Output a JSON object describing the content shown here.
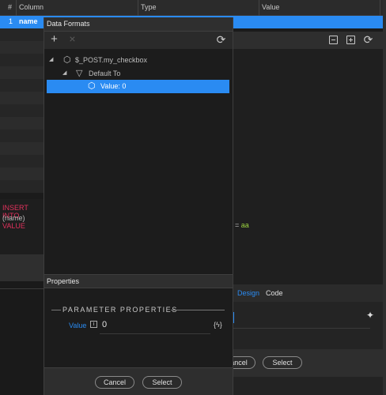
{
  "table": {
    "headers": [
      "#",
      "Column",
      "Type",
      "Value"
    ],
    "row": {
      "num": "1",
      "name": "name"
    }
  },
  "sql": {
    "line1": "INSERT INTO",
    "line2a": "(name) ",
    "line2b": "VALUE"
  },
  "dialog": {
    "title": "Data Formats",
    "tree": [
      {
        "label": "$_POST.my_checkbox"
      },
      {
        "label": "Default To"
      },
      {
        "label": "Value: 0"
      }
    ],
    "properties_title": "Properties",
    "param_heading": "PARAMETER PROPERTIES",
    "param_label": "Value",
    "param_value": "0",
    "param_expr_icon": "{ϟ}",
    "cancel_label": "Cancel",
    "select_label": "Select"
  },
  "right": {
    "code_text": "= ",
    "code_value": "aa",
    "tab_design": "Design",
    "tab_code": "Code",
    "cancel_label": "ancel",
    "select_label": "Select"
  },
  "colors": {
    "accent": "#2a8bf2",
    "sql_keyword": "#e0315c",
    "code_value": "#9bd33f"
  }
}
